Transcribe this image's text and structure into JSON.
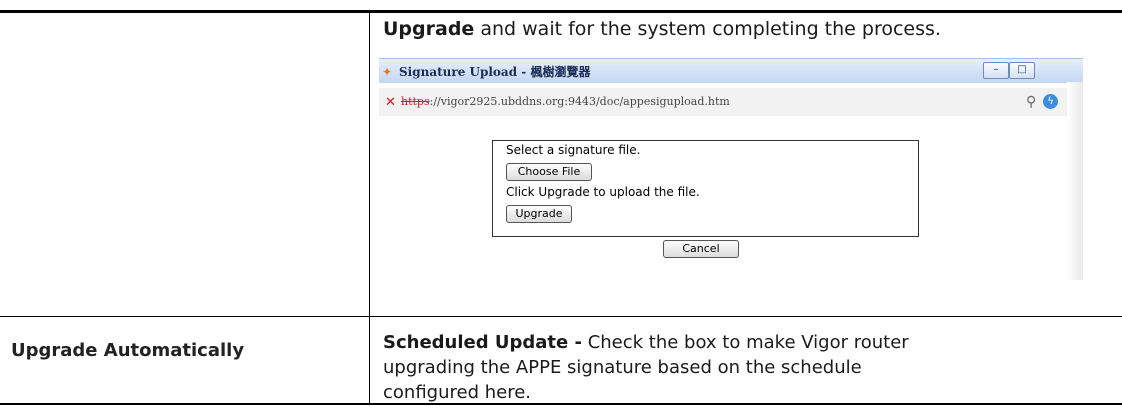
{
  "intro": {
    "bold": "Upgrade",
    "rest": " and wait for the system completing the process."
  },
  "popup": {
    "title": "Signature Upload - 楓樹瀏覽器",
    "address_proto": "https",
    "address_rest": "://vigor2925.ubddns.org:9443/doc/appesigupload.htm",
    "select_text": "Select a signature file.",
    "choose_label": "Choose File",
    "click_text": "Click Upgrade to upload the file.",
    "upgrade_label": "Upgrade",
    "cancel_label": "Cancel"
  },
  "row2": {
    "label": "Upgrade Automatically",
    "desc_bold": "Scheduled Update -",
    "desc_line1": " Check the box to make Vigor router",
    "desc_line2": "upgrading the APPE signature based on the schedule",
    "desc_line3": "configured here."
  }
}
